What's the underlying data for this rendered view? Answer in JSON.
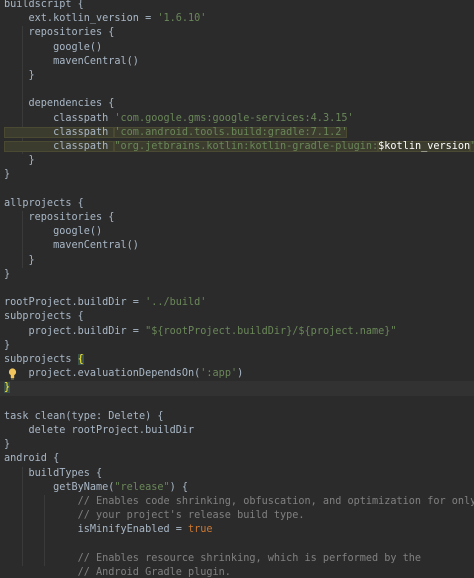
{
  "editor": {
    "colors": {
      "background": "#2b2b2b",
      "text": "#a9b7c6",
      "string": "#6a8759",
      "keyword": "#cc7832",
      "comment": "#808080",
      "current_line": "#323232",
      "bulb": "#f2c55c"
    },
    "gutter_icon": "lightbulb-icon",
    "lines": [
      [
        {
          "t": "buildscript {"
        }
      ],
      [
        {
          "t": "    ext.kotlin_version = "
        },
        {
          "t": "'1.6.10'",
          "c": "str"
        }
      ],
      [
        {
          "t": "    repositories {"
        }
      ],
      [
        {
          "t": "        google()"
        }
      ],
      [
        {
          "t": "        mavenCentral()"
        }
      ],
      [
        {
          "t": "    }"
        }
      ],
      [],
      [
        {
          "t": "    dependencies {"
        }
      ],
      [
        {
          "t": "        classpath "
        },
        {
          "t": "'com.google.gms:google-services:4.3.15'",
          "c": "str"
        }
      ],
      [
        {
          "t": "        classpath ",
          "c": "hl"
        },
        {
          "t": "'com.android.tools.build:gradle:7.1.2'",
          "c": "str hl"
        }
      ],
      [
        {
          "t": "        classpath ",
          "c": "hl"
        },
        {
          "t": "\"org.jetbrains.kotlin:kotlin-gradle-plugin:",
          "c": "str hl"
        },
        {
          "t": "$kotlin_version",
          "c": "var hl"
        },
        {
          "t": "\"",
          "c": "str hl"
        }
      ],
      [
        {
          "t": "    }"
        }
      ],
      [
        {
          "t": "}"
        }
      ],
      [],
      [
        {
          "t": "allprojects {"
        }
      ],
      [
        {
          "t": "    repositories {"
        }
      ],
      [
        {
          "t": "        google()"
        }
      ],
      [
        {
          "t": "        mavenCentral()"
        }
      ],
      [
        {
          "t": "    }"
        }
      ],
      [
        {
          "t": "}"
        }
      ],
      [],
      [
        {
          "t": "rootProject.buildDir = "
        },
        {
          "t": "'../build'",
          "c": "str"
        }
      ],
      [
        {
          "t": "subprojects {"
        }
      ],
      [
        {
          "t": "    project.buildDir = "
        },
        {
          "t": "\"${rootProject.buildDir}/${project.name}\"",
          "c": "str"
        }
      ],
      [
        {
          "t": "}"
        }
      ],
      [
        {
          "t": "subprojects "
        },
        {
          "t": "{",
          "c": "match"
        }
      ],
      [
        {
          "t": "    project.evaluationDependsOn("
        },
        {
          "t": "':app'",
          "c": "str"
        },
        {
          "t": ")"
        }
      ],
      [
        {
          "t": "}",
          "c": "match"
        }
      ],
      [],
      [
        {
          "t": "task clean("
        },
        {
          "t": "type",
          "c": "param"
        },
        {
          "t": ": Delete) {"
        }
      ],
      [
        {
          "t": "    delete rootProject.buildDir"
        }
      ],
      [
        {
          "t": "}"
        }
      ],
      [
        {
          "t": "android {"
        }
      ],
      [
        {
          "t": "    buildTypes {"
        }
      ],
      [
        {
          "t": "        getByName("
        },
        {
          "t": "\"release\"",
          "c": "str"
        },
        {
          "t": ") {"
        }
      ],
      [
        {
          "t": "            // Enables code shrinking, obfuscation, and optimization for only",
          "c": "cmt"
        }
      ],
      [
        {
          "t": "            // your project's release build type.",
          "c": "cmt"
        }
      ],
      [
        {
          "t": "            isMinifyEnabled = "
        },
        {
          "t": "true",
          "c": "kw"
        }
      ],
      [],
      [
        {
          "t": "            // Enables resource shrinking, which is performed by the",
          "c": "cmt"
        }
      ],
      [
        {
          "t": "            // Android Gradle plugin.",
          "c": "cmt"
        }
      ]
    ],
    "current_line": 27,
    "bulb_line": 26
  }
}
